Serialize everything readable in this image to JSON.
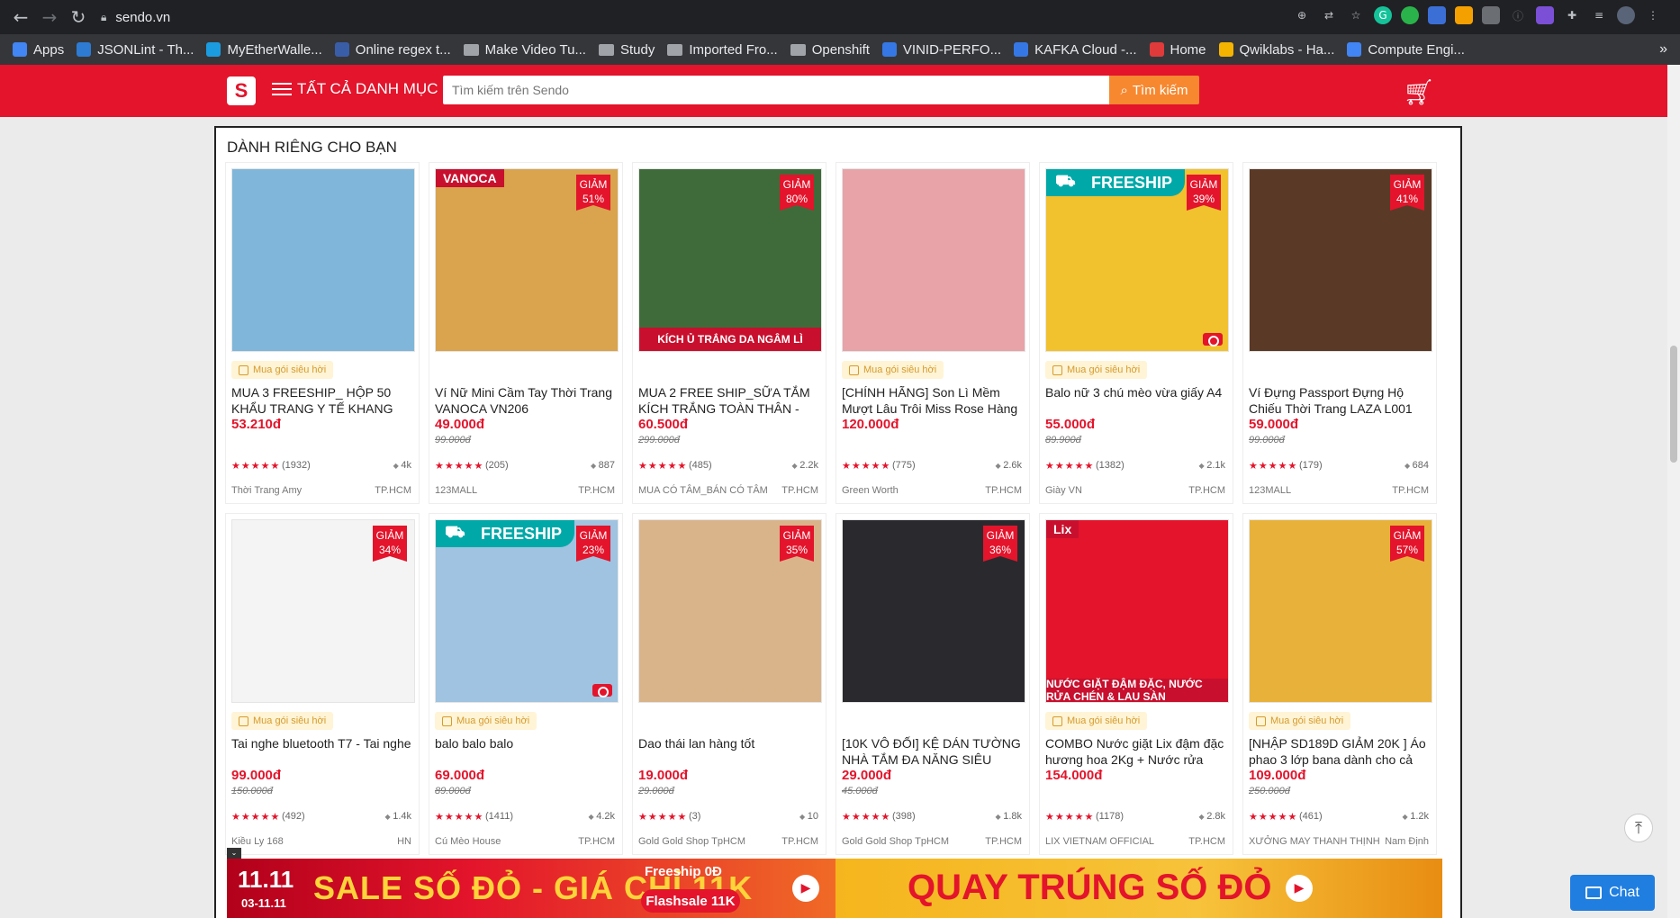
{
  "browser": {
    "url": "sendo.vn",
    "bookmarks": [
      {
        "label": "Apps",
        "color": "#4285f4"
      },
      {
        "label": "JSONLint - Th...",
        "color": "#2d7bd3"
      },
      {
        "label": "MyEtherWalle...",
        "color": "#1c9ce0"
      },
      {
        "label": "Online regex t...",
        "color": "#3a5da8"
      },
      {
        "label": "Make Video Tu...",
        "folder": true
      },
      {
        "label": "Study",
        "folder": true
      },
      {
        "label": "Imported Fro...",
        "folder": true
      },
      {
        "label": "Openshift",
        "folder": true
      },
      {
        "label": "VINID-PERFO...",
        "color": "#3578e5"
      },
      {
        "label": "KAFKA Cloud -...",
        "color": "#3578e5"
      },
      {
        "label": "Home",
        "color": "#e03a3a"
      },
      {
        "label": "Qwiklabs - Ha...",
        "color": "#f4b400"
      },
      {
        "label": "Compute Engi...",
        "color": "#4285f4"
      }
    ]
  },
  "header": {
    "category_label": "TẤT CẢ DANH MỤC",
    "search_placeholder": "Tìm kiếm trên Sendo",
    "search_button": "Tìm kiếm"
  },
  "section": {
    "title": "DÀNH RIÊNG CHO BẠN"
  },
  "products": [
    {
      "pill": "Mua gói siêu hời",
      "name": "MUA 3 FREESHIP_ HỘP 50 KHẨU TRANG Y TẾ KHANG VIỆT_...",
      "price": "53.210đ",
      "old_price": "",
      "stars": "★★★★★",
      "reviews": "(1932)",
      "sold": "4k",
      "shop": "Thời Trang Amy",
      "location": "TP.HCM",
      "discount": "",
      "thumb_color": "#7fb6d9",
      "freeship": false,
      "brand_tag": "",
      "strip": ""
    },
    {
      "pill": "",
      "name": "Ví Nữ Mini Cầm Tay Thời Trang VANOCA VN206",
      "price": "49.000đ",
      "old_price": "99.000đ",
      "stars": "★★★★★",
      "reviews": "(205)",
      "sold": "887",
      "shop": "123MALL",
      "location": "TP.HCM",
      "discount": "GIẢM 51%",
      "thumb_color": "#d9a44d",
      "freeship": false,
      "brand_tag": "VANOCA",
      "strip": ""
    },
    {
      "pill": "",
      "name": "MUA 2 FREE SHIP_SỮA TẮM KÍCH TRẮNG TOÀN THÂN - BẬ...",
      "price": "60.500đ",
      "old_price": "299.000đ",
      "stars": "★★★★★",
      "reviews": "(485)",
      "sold": "2.2k",
      "shop": "MUA CÓ TÂM_BÁN CÓ TÂM",
      "location": "TP.HCM",
      "discount": "GIẢM 80%",
      "thumb_color": "#3f6b3a",
      "freeship": false,
      "brand_tag": "",
      "strip": "KÍCH Ủ TRẮNG DA NGÂM LÌ"
    },
    {
      "pill": "Mua gói siêu hời",
      "name": "[CHÍNH HÃNG] Son Lì Mềm Mượt Lâu Trôi Miss Rose Hàng Trung...",
      "price": "120.000đ",
      "old_price": "",
      "stars": "★★★★★",
      "reviews": "(775)",
      "sold": "2.6k",
      "shop": "Green Worth",
      "location": "TP.HCM",
      "discount": "",
      "thumb_color": "#e7a3a8",
      "freeship": false,
      "brand_tag": "",
      "strip": ""
    },
    {
      "pill": "Mua gói siêu hời",
      "name": "Balo nữ 3 chú mèo vừa giấy A4",
      "price": "55.000đ",
      "old_price": "89.900đ",
      "stars": "★★★★★",
      "reviews": "(1382)",
      "sold": "2.1k",
      "shop": "Giày VN",
      "location": "TP.HCM",
      "discount": "GIẢM 39%",
      "thumb_color": "#f2c12e",
      "freeship": true,
      "brand_tag": "",
      "strip": ""
    },
    {
      "pill": "",
      "name": "Ví Đựng Passport Đựng Hộ Chiếu Thời Trang LAZA L001",
      "price": "59.000đ",
      "old_price": "99.000đ",
      "stars": "★★★★★",
      "reviews": "(179)",
      "sold": "684",
      "shop": "123MALL",
      "location": "TP.HCM",
      "discount": "GIẢM 41%",
      "thumb_color": "#5a3a26",
      "freeship": false,
      "brand_tag": "",
      "strip": ""
    },
    {
      "pill": "Mua gói siêu hời",
      "name": "Tai nghe bluetooth T7 - Tai nghe",
      "price": "99.000đ",
      "old_price": "150.000đ",
      "stars": "★★★★★",
      "reviews": "(492)",
      "sold": "1.4k",
      "shop": "Kiều Ly 168",
      "location": "HN",
      "discount": "GIẢM 34%",
      "thumb_color": "#f4f4f4",
      "freeship": false,
      "brand_tag": "",
      "strip": ""
    },
    {
      "pill": "Mua gói siêu hời",
      "name": "balo balo balo",
      "price": "69.000đ",
      "old_price": "89.000đ",
      "stars": "★★★★★",
      "reviews": "(1411)",
      "sold": "4.2k",
      "shop": "Cú Mèo House",
      "location": "TP.HCM",
      "discount": "GIẢM 23%",
      "thumb_color": "#9fc3e0",
      "freeship": true,
      "brand_tag": "",
      "strip": ""
    },
    {
      "pill": "",
      "name": "Dao thái lan hàng tốt",
      "price": "19.000đ",
      "old_price": "29.000đ",
      "stars": "★★★★★",
      "reviews": "(3)",
      "sold": "10",
      "shop": "Gold Gold Shop TpHCM",
      "location": "TP.HCM",
      "discount": "GIẢM 35%",
      "thumb_color": "#d9b48a",
      "freeship": false,
      "brand_tag": "",
      "strip": ""
    },
    {
      "pill": "",
      "name": "[10K VÔ ĐỐI] KỆ DÁN TƯỜNG NHÀ TẮM ĐA NĂNG SIÊU CHẮ...",
      "price": "29.000đ",
      "old_price": "45.000đ",
      "stars": "★★★★★",
      "reviews": "(398)",
      "sold": "1.8k",
      "shop": "Gold Gold Shop TpHCM",
      "location": "TP.HCM",
      "discount": "GIẢM 36%",
      "thumb_color": "#2a2a2e",
      "freeship": false,
      "brand_tag": "",
      "strip": ""
    },
    {
      "pill": "Mua gói siêu hời",
      "name": "COMBO Nước giặt Lix đậm đặc hương hoa 2Kg + Nước rửa ché...",
      "price": "154.000đ",
      "old_price": "",
      "stars": "★★★★★",
      "reviews": "(1178)",
      "sold": "2.8k",
      "shop": "LIX VIETNAM OFFICIAL",
      "location": "TP.HCM",
      "discount": "",
      "thumb_color": "#e3142b",
      "freeship": false,
      "brand_tag": "Lix",
      "strip": "NƯỚC GIẶT ĐẬM ĐẶC, NƯỚC RỬA CHÉN & LAU SÀN"
    },
    {
      "pill": "Mua gói siêu hời",
      "name": "[NHẬP SD189D GIẢM 20K ] Áo phao 3 lớp bana dành cho cả bé...",
      "price": "109.000đ",
      "old_price": "250.000đ",
      "stars": "★★★★★",
      "reviews": "(461)",
      "sold": "1.2k",
      "shop": "XƯỞNG MAY THANH THỊNH",
      "location": "Nam Định",
      "discount": "GIẢM 57%",
      "thumb_color": "#e8b23a",
      "freeship": false,
      "brand_tag": "",
      "strip": ""
    }
  ],
  "banner": {
    "date_main": "11.11",
    "date_range": "03-11.11",
    "left_text": "SALE SỐ ĐỎ - GIÁ CHỈ 11K",
    "freeship_text": "Freeship 0Đ",
    "flashsale_text": "Flashsale 11K",
    "right_text": "QUAY TRÚNG SỐ ĐỎ"
  },
  "chat": {
    "label": "Chat"
  }
}
